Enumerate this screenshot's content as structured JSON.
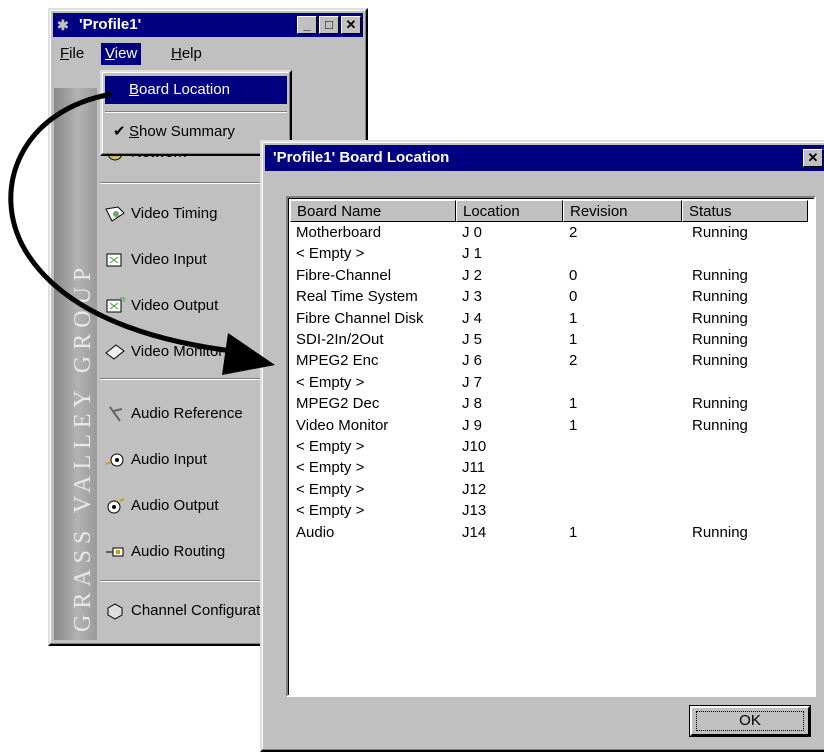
{
  "main_window": {
    "title": "'Profile1'",
    "controls": {
      "minimize": "_",
      "maximize": "□",
      "close": "✕"
    },
    "menu": [
      {
        "label": "File",
        "mnemonic_rest": "ile",
        "mnemonic": "F"
      },
      {
        "label": "View",
        "mnemonic_rest": "iew",
        "mnemonic": "V"
      },
      {
        "label": "Help",
        "mnemonic_rest": "elp",
        "mnemonic": "H"
      }
    ],
    "brand_text": "GRASS VALLEY GROUP",
    "nav_items": [
      {
        "label": "Network",
        "icon": "network-icon"
      },
      {
        "label": "Video Timing",
        "icon": "video-timing-icon"
      },
      {
        "label": "Video Input",
        "icon": "video-input-icon"
      },
      {
        "label": "Video Output",
        "icon": "video-output-icon"
      },
      {
        "label": "Video Monitor",
        "icon": "video-monitor-icon"
      },
      {
        "label": "Audio Reference",
        "icon": "audio-reference-icon"
      },
      {
        "label": "Audio Input",
        "icon": "audio-input-icon"
      },
      {
        "label": "Audio Output",
        "icon": "audio-output-icon"
      },
      {
        "label": "Audio Routing",
        "icon": "audio-routing-icon"
      },
      {
        "label": "Channel Configuration",
        "icon": "channel-config-icon"
      }
    ]
  },
  "view_menu": {
    "items": [
      {
        "first": "B",
        "rest": "oard Location",
        "checked": false,
        "highlighted": true
      },
      {
        "first": "S",
        "rest": "how Summary",
        "checked": true,
        "highlighted": false
      }
    ],
    "check_glyph": "✔"
  },
  "dialog": {
    "title": "'Profile1' Board Location",
    "close": "✕",
    "columns": [
      "Board Name",
      "Location",
      "Revision",
      "Status"
    ],
    "rows": [
      {
        "name": "Motherboard",
        "location": "J 0",
        "revision": "2",
        "status": "Running"
      },
      {
        "name": "< Empty >",
        "location": "J 1",
        "revision": "",
        "status": ""
      },
      {
        "name": "Fibre-Channel",
        "location": "J 2",
        "revision": "0",
        "status": "Running"
      },
      {
        "name": "Real Time System",
        "location": "J 3",
        "revision": "0",
        "status": "Running"
      },
      {
        "name": "Fibre Channel Disk",
        "location": "J 4",
        "revision": "1",
        "status": "Running"
      },
      {
        "name": "SDI-2In/2Out",
        "location": "J 5",
        "revision": "1",
        "status": "Running"
      },
      {
        "name": "MPEG2 Enc",
        "location": "J 6",
        "revision": "2",
        "status": "Running"
      },
      {
        "name": "< Empty >",
        "location": "J 7",
        "revision": "",
        "status": ""
      },
      {
        "name": "MPEG2 Dec",
        "location": "J 8",
        "revision": "1",
        "status": "Running"
      },
      {
        "name": "Video Monitor",
        "location": "J 9",
        "revision": "1",
        "status": "Running"
      },
      {
        "name": "< Empty >",
        "location": "J10",
        "revision": "",
        "status": ""
      },
      {
        "name": "< Empty >",
        "location": "J11",
        "revision": "",
        "status": ""
      },
      {
        "name": "< Empty >",
        "location": "J12",
        "revision": "",
        "status": ""
      },
      {
        "name": "< Empty >",
        "location": "J13",
        "revision": "",
        "status": ""
      },
      {
        "name": "Audio",
        "location": "J14",
        "revision": "1",
        "status": "Running"
      }
    ],
    "ok_label": "OK"
  },
  "colors": {
    "title_bar": "#000080",
    "face": "#c0c0c0",
    "highlight": "#000080"
  }
}
